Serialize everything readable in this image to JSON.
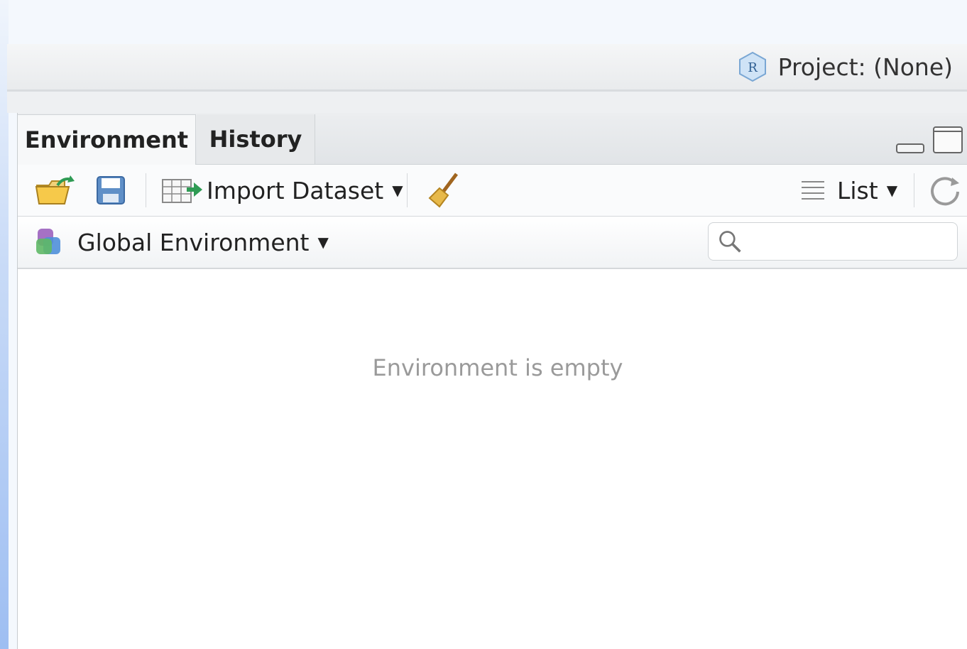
{
  "project": {
    "label": "Project: (None)",
    "icon": "r-project-icon"
  },
  "tabs": [
    {
      "label": "Environment",
      "active": true
    },
    {
      "label": "History",
      "active": false
    }
  ],
  "toolbar": {
    "import_label": "Import Dataset",
    "view_label": "List",
    "icons": [
      "open-folder-icon",
      "save-icon",
      "import-dataset-icon",
      "broom-icon",
      "list-view-icon",
      "refresh-icon"
    ]
  },
  "env_selector": {
    "label": "Global Environment",
    "icon": "environment-icon"
  },
  "search": {
    "value": "",
    "placeholder": ""
  },
  "main": {
    "empty_message": "Environment is empty"
  },
  "colors": {
    "accent_blue": "#4a90d9",
    "icon_green": "#3a9a4a",
    "text": "#222222",
    "muted_text": "#9a9a9a"
  }
}
